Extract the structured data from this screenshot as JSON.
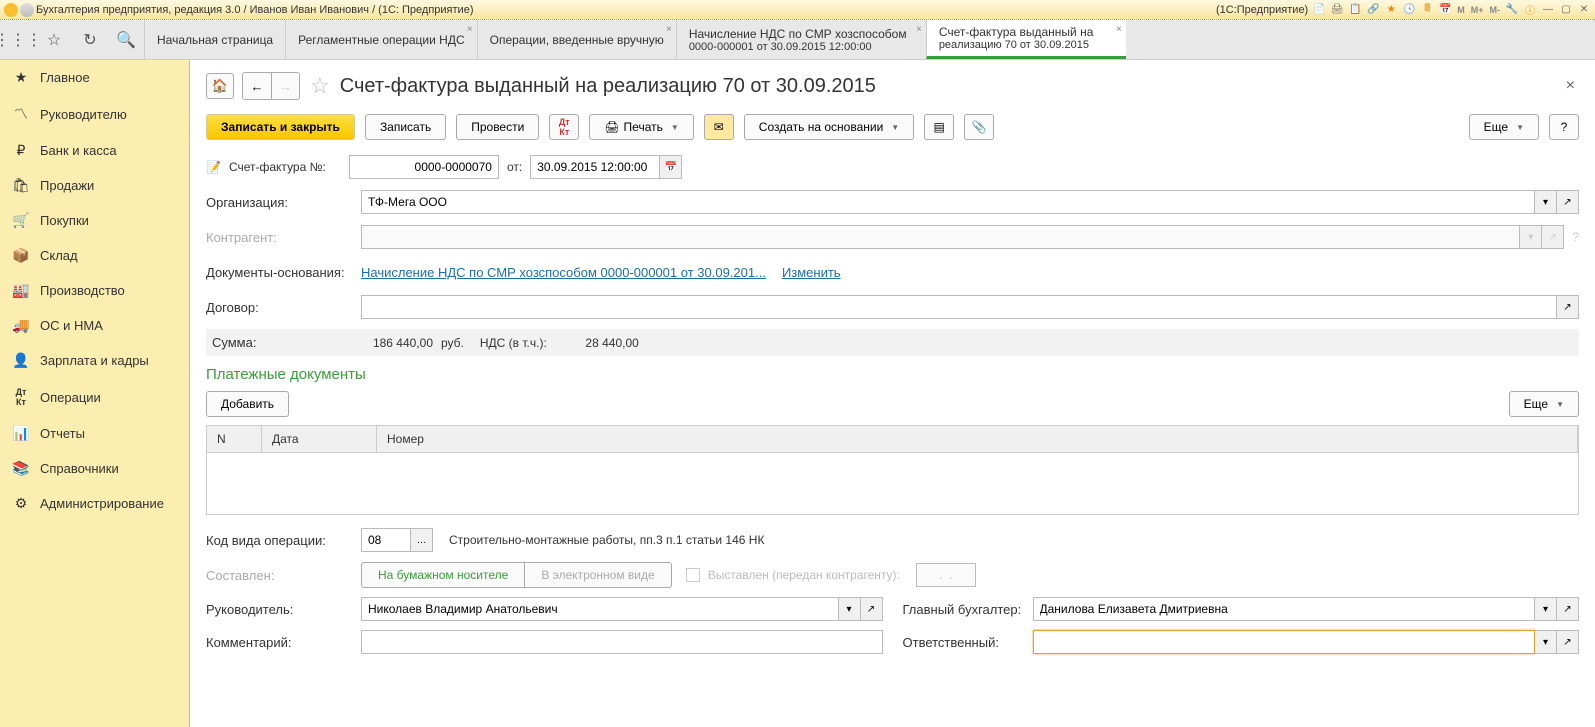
{
  "titlebar": {
    "app_title": "Бухгалтерия предприятия, редакция 3.0 / Иванов Иван Иванович / (1С: Предприятие)",
    "right_hint": "(1С:Предприятие)",
    "memory_labels": [
      "M",
      "M+",
      "M-"
    ]
  },
  "tabs": [
    {
      "label": "Начальная страница",
      "line2": "",
      "closable": false
    },
    {
      "label": "Регламентные операции НДС",
      "line2": "",
      "closable": true
    },
    {
      "label": "Операции, введенные вручную",
      "line2": "",
      "closable": true
    },
    {
      "label": "Начисление НДС по СМР хозспособом",
      "line2": "0000-000001 от 30.09.2015 12:00:00",
      "closable": true
    },
    {
      "label": "Счет-фактура выданный на",
      "line2": "реализацию 70 от 30.09.2015",
      "closable": true,
      "active": true
    }
  ],
  "sidebar": [
    {
      "icon": "★",
      "label": "Главное"
    },
    {
      "icon": "📈",
      "label": "Руководителю"
    },
    {
      "icon": "₽",
      "label": "Банк и касса"
    },
    {
      "icon": "🛍",
      "label": "Продажи"
    },
    {
      "icon": "🛒",
      "label": "Покупки"
    },
    {
      "icon": "📦",
      "label": "Склад"
    },
    {
      "icon": "🏭",
      "label": "Производство"
    },
    {
      "icon": "🚚",
      "label": "ОС и НМА"
    },
    {
      "icon": "👤",
      "label": "Зарплата и кадры"
    },
    {
      "icon": "Дт",
      "label": "Операции"
    },
    {
      "icon": "📊",
      "label": "Отчеты"
    },
    {
      "icon": "📚",
      "label": "Справочники"
    },
    {
      "icon": "⚙",
      "label": "Администрирование"
    }
  ],
  "page": {
    "title": "Счет-фактура выданный на реализацию 70 от 30.09.2015"
  },
  "toolbar": {
    "save_close": "Записать и закрыть",
    "save": "Записать",
    "post": "Провести",
    "print": "Печать",
    "create_based": "Создать на основании",
    "more": "Еще"
  },
  "fields": {
    "invoice_no_label": "Счет-фактура №:",
    "invoice_no": "0000-0000070",
    "from_label": "от:",
    "date": "30.09.2015 12:00:00",
    "org_label": "Организация:",
    "org": "ТФ-Мега ООО",
    "contragent_label": "Контрагент:",
    "contragent": "",
    "basis_label": "Документы-основания:",
    "basis_link": "Начисление НДС по СМР хозспособом 0000-000001 от 30.09.201...",
    "change_link": "Изменить",
    "contract_label": "Договор:",
    "contract": "",
    "sum_label": "Сумма:",
    "sum": "186 440,00",
    "currency": "руб.",
    "vat_label": "НДС (в т.ч.):",
    "vat": "28 440,00",
    "payment_section": "Платежные документы",
    "add_btn": "Добавить",
    "more2": "Еще",
    "th_n": "N",
    "th_date": "Дата",
    "th_num": "Номер",
    "opcode_label": "Код вида операции:",
    "opcode": "08",
    "opcode_desc": "Строительно-монтажные работы, пп.3 п.1 статьи 146 НК",
    "issued_label": "Составлен:",
    "paper": "На бумажном носителе",
    "electronic": "В электронном виде",
    "sent_label": "Выставлен (передан контрагенту):",
    "sent_date": ".  .",
    "manager_label": "Руководитель:",
    "manager": "Николаев Владимир Анатольевич",
    "accountant_label": "Главный бухгалтер:",
    "accountant": "Данилова Елизавета Дмитриевна",
    "comment_label": "Комментарий:",
    "comment": "",
    "responsible_label": "Ответственный:",
    "responsible": ""
  }
}
